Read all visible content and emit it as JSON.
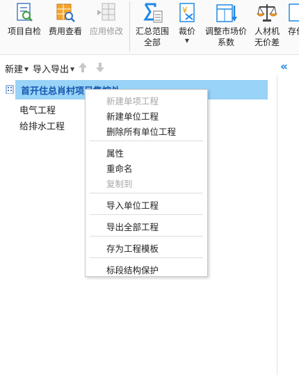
{
  "ribbon": {
    "project_check": "项目自检",
    "fee_view": "费用查看",
    "apply_modify": "应用修改",
    "summary_range_l1": "汇总范围",
    "summary_range_l2": "全部",
    "price": "裁价",
    "adjust_market_l1": "调整市场价",
    "adjust_market_l2": "系数",
    "labor_material_l1": "人材机",
    "labor_material_l2": "无价差",
    "save_partial": "存价"
  },
  "toolbar": {
    "new_label": "新建",
    "import_export_label": "导入导出"
  },
  "tree": {
    "root": "首开住总肖村项目集控处",
    "items": [
      "电气工程",
      "给排水工程"
    ]
  },
  "context_menu": {
    "new_single_project": "新建单项工程",
    "new_unit_project": "新建单位工程",
    "delete_all_units": "删除所有单位工程",
    "properties": "属性",
    "rename": "重命名",
    "copy_to": "复制到",
    "import_unit_project": "导入单位工程",
    "export_all_projects": "导出全部工程",
    "save_as_template": "存为工程模板",
    "section_structure_protect": "标段结构保护"
  },
  "colors": {
    "selection": "#99d3f7",
    "accent_blue": "#1e88e5",
    "disabled_text": "#a7a7a7"
  }
}
